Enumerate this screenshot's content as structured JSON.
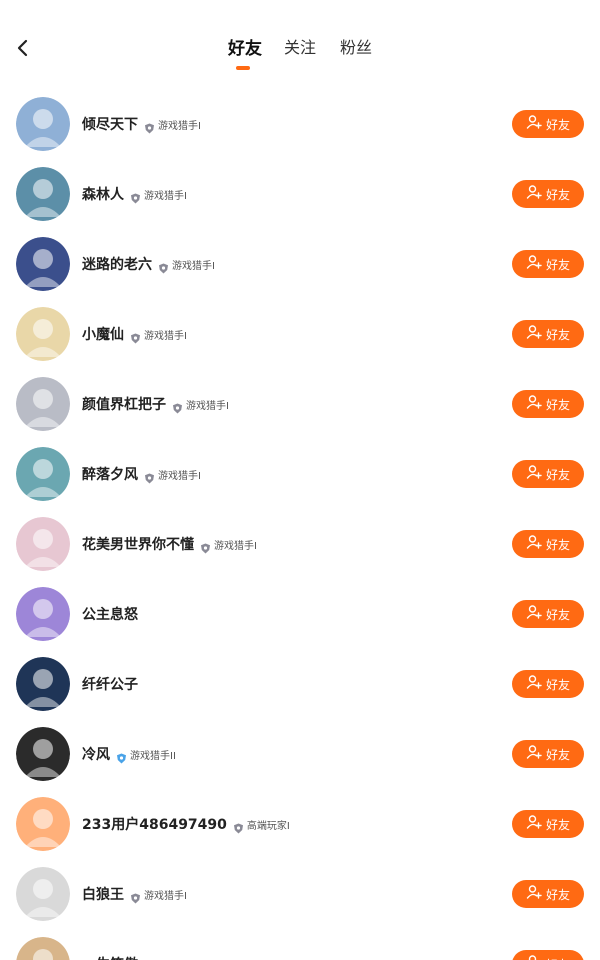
{
  "header": {
    "tabs": [
      {
        "label": "好友",
        "active": true
      },
      {
        "label": "关注",
        "active": false
      },
      {
        "label": "粉丝",
        "active": false
      }
    ]
  },
  "colors": {
    "accent": "#ff6a13"
  },
  "friend_button_label": "好友",
  "users": [
    {
      "name": "倾尽天下",
      "badge": "游戏猎手I",
      "badge_icon": "shield-gray",
      "avatar_color": "#8fb0d6"
    },
    {
      "name": "森林人",
      "badge": "游戏猎手I",
      "badge_icon": "shield-gray",
      "avatar_color": "#5c8fa8"
    },
    {
      "name": "迷路的老六",
      "badge": "游戏猎手I",
      "badge_icon": "shield-gray",
      "avatar_color": "#3b4f8c"
    },
    {
      "name": "小魔仙",
      "badge": "游戏猎手I",
      "badge_icon": "shield-gray",
      "avatar_color": "#e9d7a8"
    },
    {
      "name": "颜值界杠把子",
      "badge": "游戏猎手I",
      "badge_icon": "shield-gray",
      "avatar_color": "#b9bcc6"
    },
    {
      "name": "醉落夕风",
      "badge": "游戏猎手I",
      "badge_icon": "shield-gray",
      "avatar_color": "#6ba7b1"
    },
    {
      "name": "花美男世界你不懂",
      "badge": "游戏猎手I",
      "badge_icon": "shield-gray",
      "avatar_color": "#e7c7d2"
    },
    {
      "name": "公主息怒",
      "badge": "",
      "badge_icon": "",
      "avatar_color": "#9d86d8"
    },
    {
      "name": "纤纤公子",
      "badge": "",
      "badge_icon": "",
      "avatar_color": "#1f3557"
    },
    {
      "name": "冷风",
      "badge": "游戏猎手II",
      "badge_icon": "shield-blue",
      "avatar_color": "#2b2b2b"
    },
    {
      "name": "233用户486497490",
      "badge": "高端玩家I",
      "badge_icon": "shield-gray",
      "avatar_color": "#ffb07a"
    },
    {
      "name": "白狼王",
      "badge": "游戏猎手I",
      "badge_icon": "shield-gray",
      "avatar_color": "#d9d9d9"
    },
    {
      "name": "一生笑傲",
      "badge": "游戏猎手I",
      "badge_icon": "shield-gray",
      "avatar_color": "#d8b58a"
    }
  ]
}
